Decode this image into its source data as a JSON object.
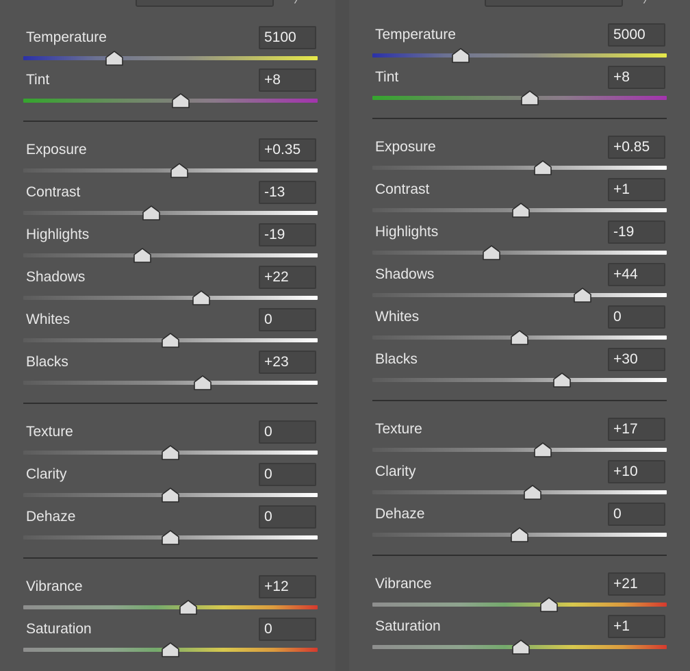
{
  "panels": [
    {
      "sliders": [
        {
          "label": "Temperature",
          "value": "5100",
          "track": "temp",
          "position": 0.31
        },
        {
          "label": "Tint",
          "value": "+8",
          "track": "tint",
          "position": 0.535
        },
        {
          "label": "Exposure",
          "value": "+0.35",
          "track": "gray",
          "position": 0.53
        },
        {
          "label": "Contrast",
          "value": "-13",
          "track": "gray",
          "position": 0.435
        },
        {
          "label": "Highlights",
          "value": "-19",
          "track": "gray",
          "position": 0.405
        },
        {
          "label": "Shadows",
          "value": "+22",
          "track": "gray",
          "position": 0.605
        },
        {
          "label": "Whites",
          "value": "0",
          "track": "gray",
          "position": 0.5
        },
        {
          "label": "Blacks",
          "value": "+23",
          "track": "gray",
          "position": 0.61
        },
        {
          "label": "Texture",
          "value": "0",
          "track": "gray",
          "position": 0.5
        },
        {
          "label": "Clarity",
          "value": "0",
          "track": "gray",
          "position": 0.5
        },
        {
          "label": "Dehaze",
          "value": "0",
          "track": "gray",
          "position": 0.5
        },
        {
          "label": "Vibrance",
          "value": "+12",
          "track": "vib",
          "position": 0.56
        },
        {
          "label": "Saturation",
          "value": "0",
          "track": "vib",
          "position": 0.5
        }
      ]
    },
    {
      "sliders": [
        {
          "label": "Temperature",
          "value": "5000",
          "track": "temp",
          "position": 0.3
        },
        {
          "label": "Tint",
          "value": "+8",
          "track": "tint",
          "position": 0.535
        },
        {
          "label": "Exposure",
          "value": "+0.85",
          "track": "gray",
          "position": 0.58
        },
        {
          "label": "Contrast",
          "value": "+1",
          "track": "gray",
          "position": 0.505
        },
        {
          "label": "Highlights",
          "value": "-19",
          "track": "gray",
          "position": 0.405
        },
        {
          "label": "Shadows",
          "value": "+44",
          "track": "gray",
          "position": 0.715
        },
        {
          "label": "Whites",
          "value": "0",
          "track": "gray",
          "position": 0.5
        },
        {
          "label": "Blacks",
          "value": "+30",
          "track": "gray",
          "position": 0.645
        },
        {
          "label": "Texture",
          "value": "+17",
          "track": "gray",
          "position": 0.58
        },
        {
          "label": "Clarity",
          "value": "+10",
          "track": "gray",
          "position": 0.545
        },
        {
          "label": "Dehaze",
          "value": "0",
          "track": "gray",
          "position": 0.5
        },
        {
          "label": "Vibrance",
          "value": "+21",
          "track": "vib",
          "position": 0.6
        },
        {
          "label": "Saturation",
          "value": "+1",
          "track": "vib",
          "position": 0.505
        }
      ]
    }
  ],
  "icons": {
    "top_tool": "eyedropper-icon",
    "thumb": "slider-thumb-icon"
  },
  "colors": {
    "background": "#535353",
    "thumb_fill": "#dcdcdc",
    "thumb_border": "#2a2a2a",
    "divider": "#2f2f2f"
  }
}
